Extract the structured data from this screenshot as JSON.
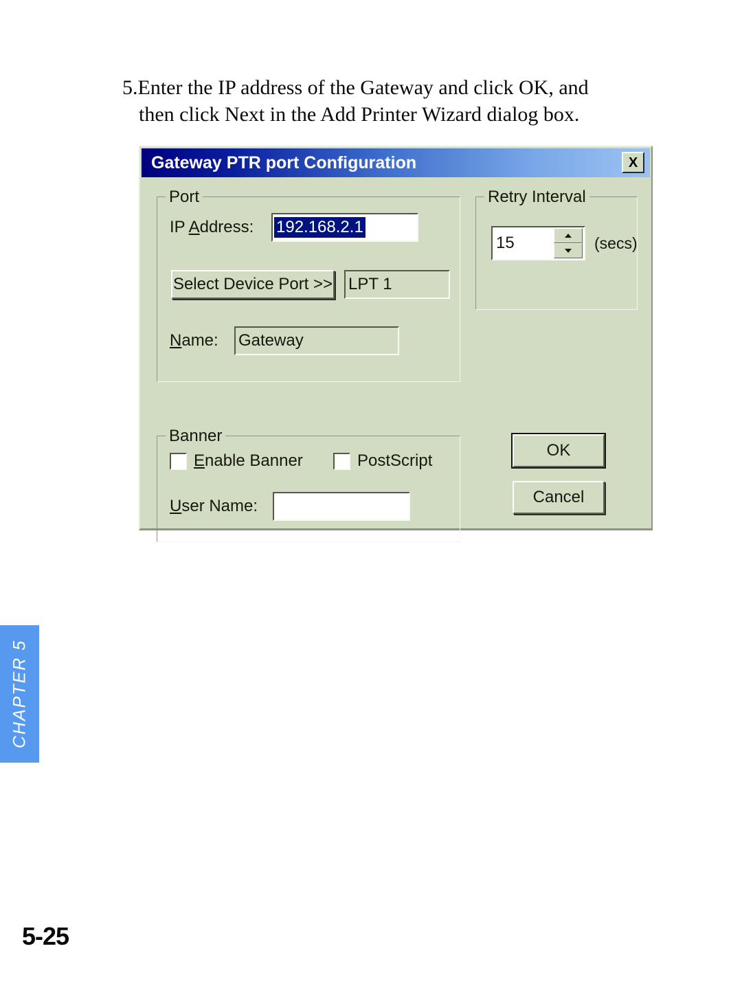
{
  "page": {
    "number": "5-25",
    "chapter_tab": "CHAPTER 5",
    "instruction": {
      "line_1": "5.Enter the IP address of the Gateway and click OK, and",
      "line_2": "then click Next in the Add Printer Wizard dialog box."
    }
  },
  "dialog": {
    "title": "Gateway PTR port Configuration",
    "close_label": "X",
    "port_group": {
      "legend": "Port",
      "ip_label_pre": "IP ",
      "ip_label_accel": "A",
      "ip_label_post": "ddress:",
      "ip_value": "192.168.2.1",
      "select_device_port_button": "Select Device Port >>",
      "device_port_value": "LPT 1",
      "name_label_accel": "N",
      "name_label_post": "ame:",
      "name_value": "Gateway"
    },
    "retry_group": {
      "legend": "Retry Interval",
      "value": "15",
      "units": "(secs)",
      "up_icon": "chevron-up-icon",
      "down_icon": "chevron-down-icon"
    },
    "banner_group": {
      "legend": "Banner",
      "enable_banner_accel": "E",
      "enable_banner_post": "nable Banner",
      "enable_banner_checked": false,
      "postscript_label": "PostScript",
      "postscript_checked": false,
      "user_name_accel": "U",
      "user_name_post": "ser Name:",
      "user_name_value": ""
    },
    "buttons": {
      "ok": "OK",
      "cancel": "Cancel"
    },
    "colors": {
      "dialog_face": "#d2dcc2",
      "titlebar_start": "#00007e",
      "titlebar_end": "#9dc2f0",
      "selection_highlight": "#00127e",
      "chapter_tab": "#5699ee"
    }
  }
}
